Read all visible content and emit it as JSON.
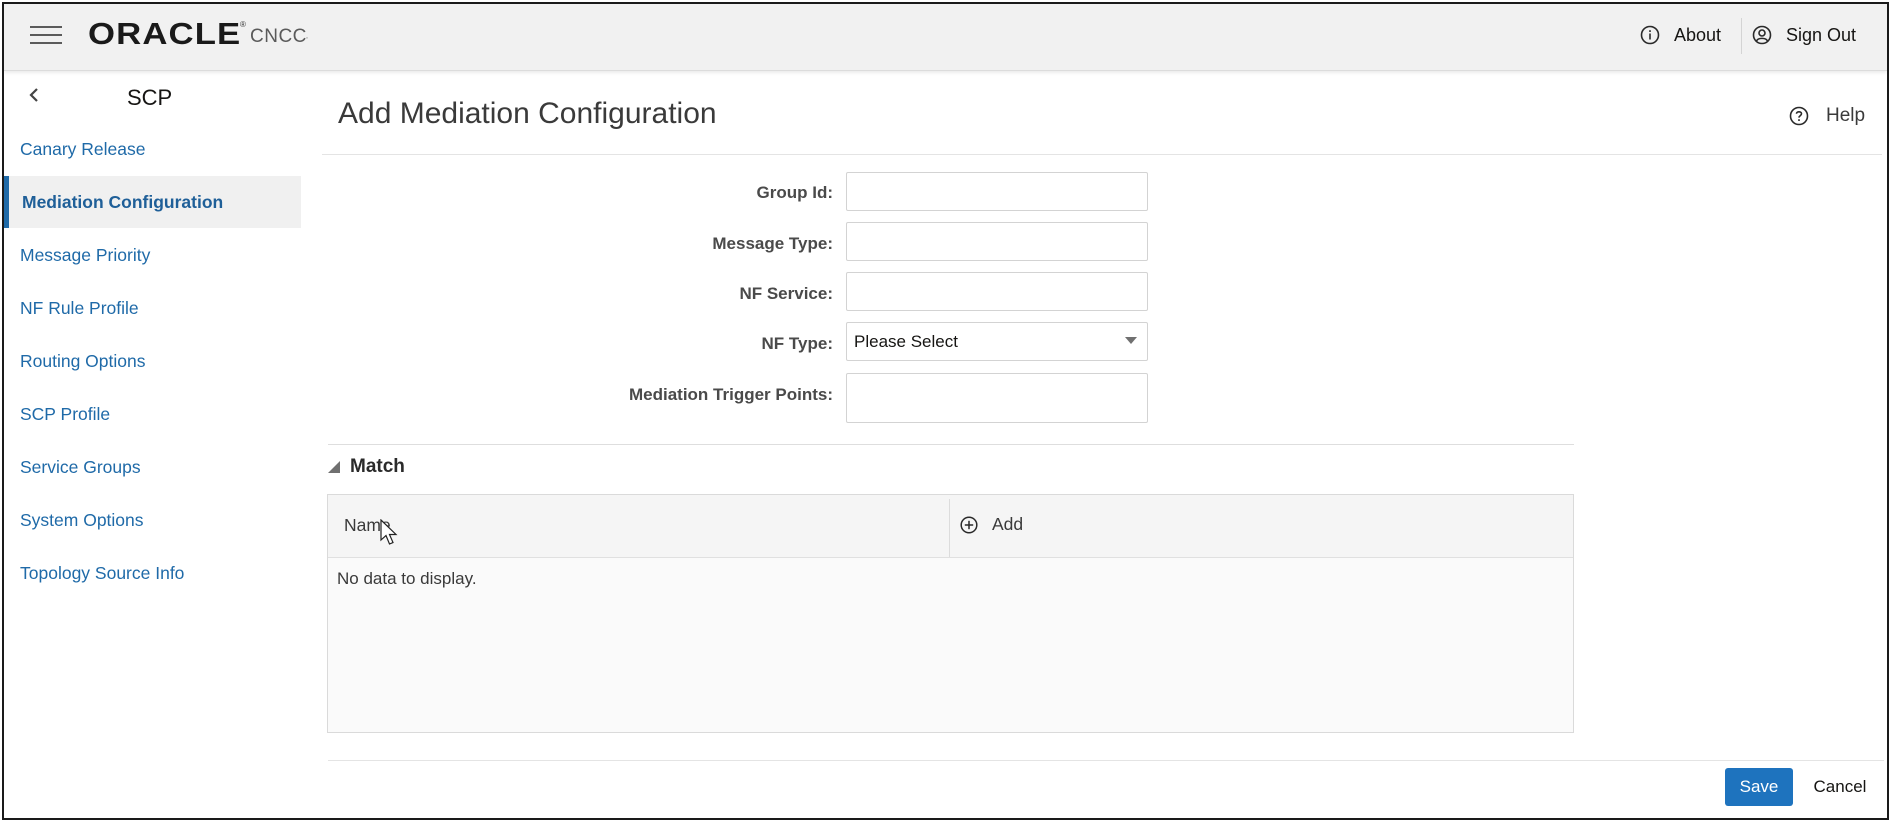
{
  "header": {
    "logo_text": "ORACLE",
    "registered_mark": "®",
    "product": "CNCC",
    "product_suffix": "·",
    "about_label": "About",
    "signout_label": "Sign Out"
  },
  "sidebar": {
    "title": "SCP",
    "items": [
      {
        "label": "Canary Release",
        "active": false
      },
      {
        "label": "Mediation Configuration",
        "active": true
      },
      {
        "label": "Message Priority",
        "active": false
      },
      {
        "label": "NF Rule Profile",
        "active": false
      },
      {
        "label": "Routing Options",
        "active": false
      },
      {
        "label": "SCP Profile",
        "active": false
      },
      {
        "label": "Service Groups",
        "active": false
      },
      {
        "label": "System Options",
        "active": false
      },
      {
        "label": "Topology Source Info",
        "active": false
      }
    ]
  },
  "main": {
    "title": "Add Mediation Configuration",
    "help_label": "Help",
    "form": {
      "group_id_label": "Group Id:",
      "group_id_value": "",
      "message_type_label": "Message Type:",
      "message_type_value": "",
      "nf_service_label": "NF Service:",
      "nf_service_value": "",
      "nf_type_label": "NF Type:",
      "nf_type_value": "Please Select",
      "trigger_points_label": "Mediation Trigger Points:",
      "trigger_points_value": ""
    },
    "match": {
      "section_label": "Match",
      "column_name": "Name",
      "add_label": "Add",
      "empty_text": "No data to display."
    },
    "footer": {
      "save_label": "Save",
      "cancel_label": "Cancel"
    }
  },
  "colors": {
    "accent": "#1e73be",
    "link": "#1f6aa8",
    "header_bg": "#f1f1f1"
  }
}
